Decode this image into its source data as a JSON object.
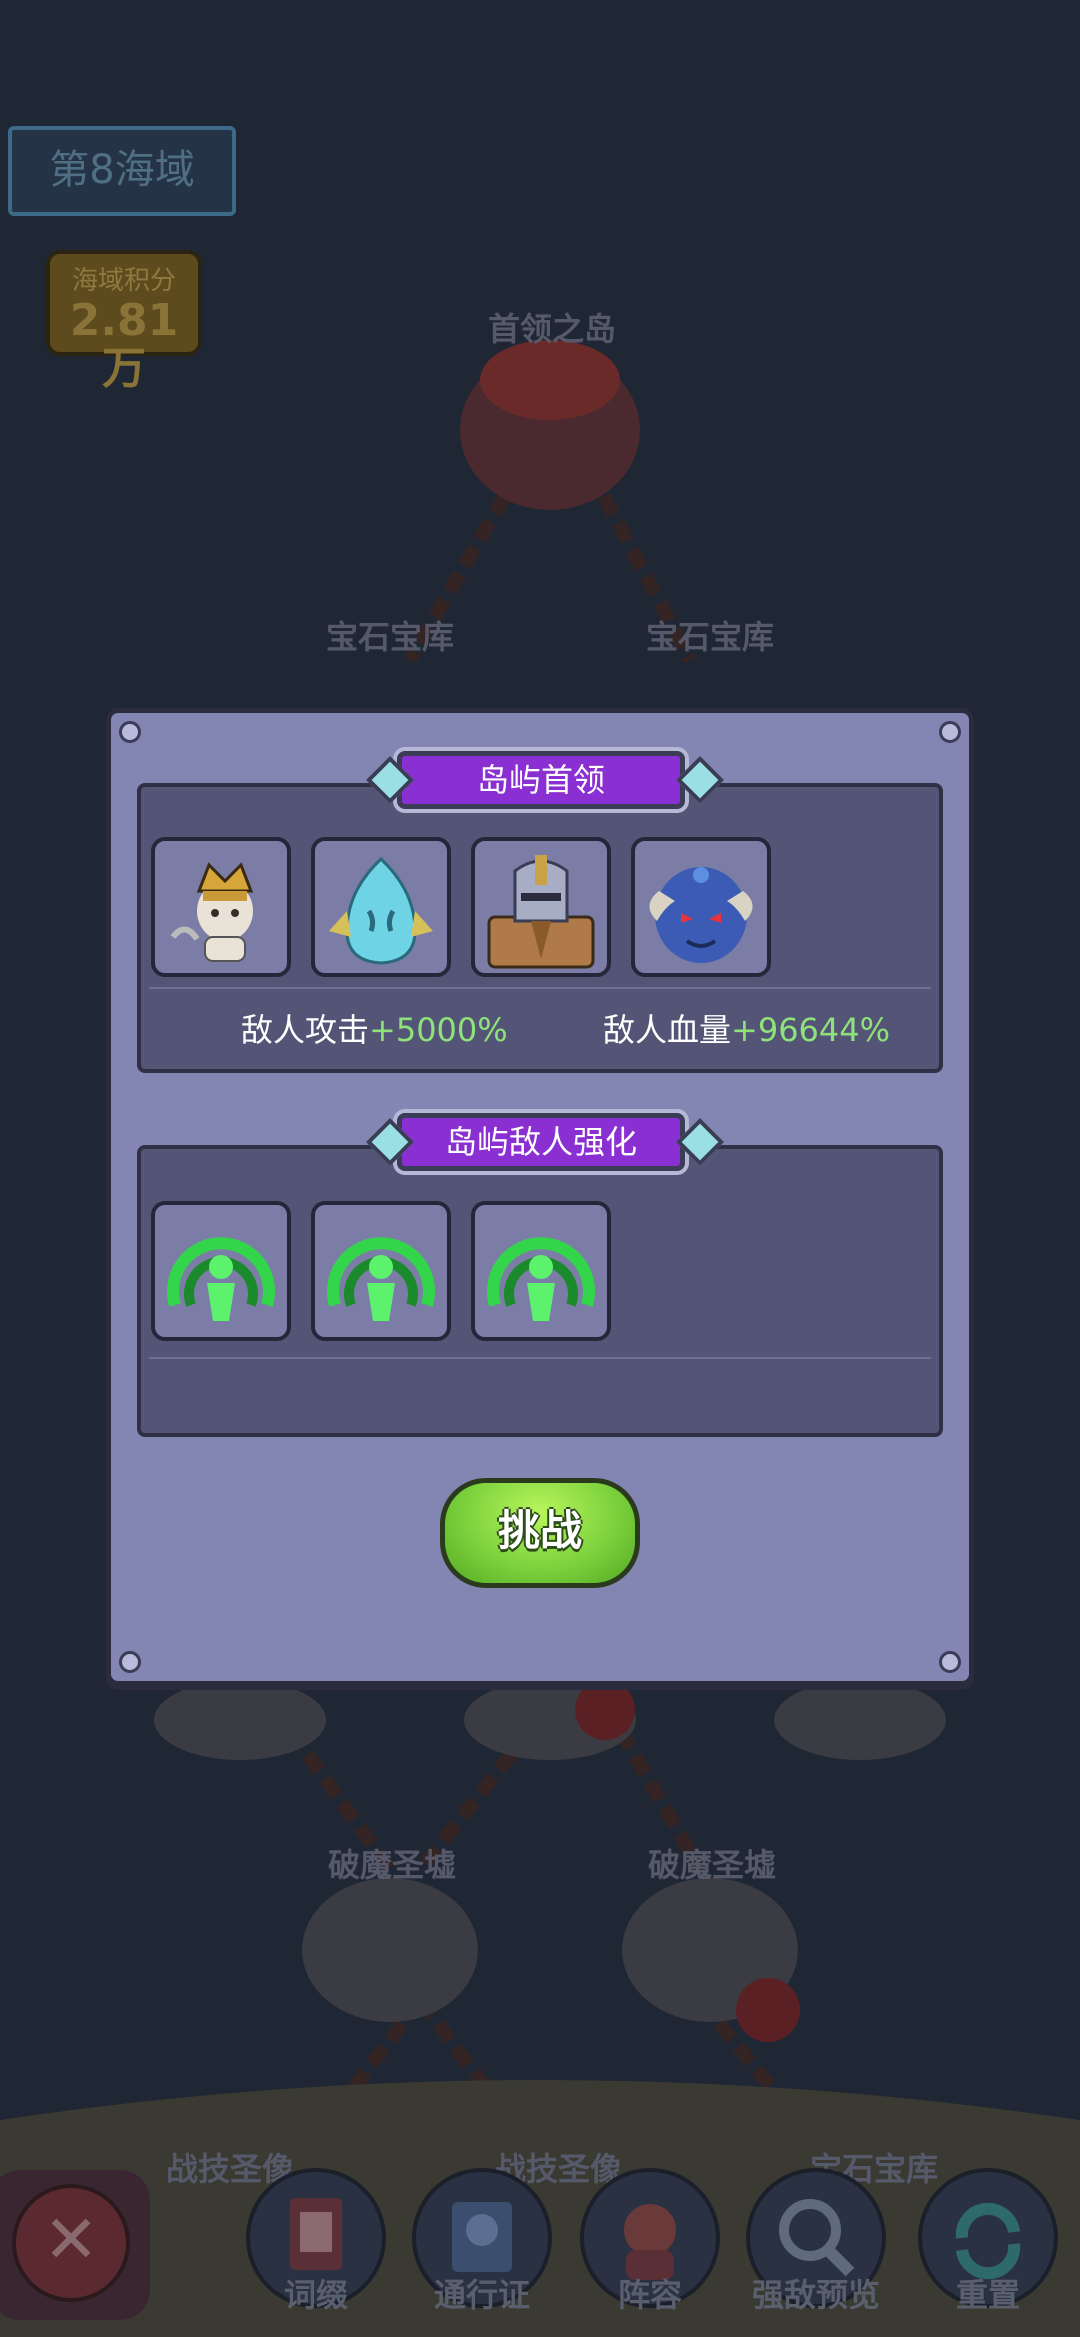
{
  "region": {
    "label": "第8海域"
  },
  "score": {
    "label": "海域积分",
    "value": "2.81万"
  },
  "map_labels": {
    "boss_island": "首领之岛",
    "gem_vault_left": "宝石宝库",
    "gem_vault_right": "宝石宝库",
    "demon_ruins_left": "破魔圣墟",
    "demon_ruins_right": "破魔圣墟",
    "combat_statue_left": "战技圣像",
    "combat_statue_mid": "战技圣像",
    "gem_vault_bottom": "宝石宝库"
  },
  "dialog": {
    "boss_section": {
      "title": "岛屿首领",
      "bosses": [
        "horned-warrior-icon",
        "water-spirit-icon",
        "armored-knight-icon",
        "blue-demon-icon"
      ],
      "attack_label": "敌人攻击",
      "attack_value": "+5000%",
      "hp_label": "敌人血量",
      "hp_value": "+96644%"
    },
    "buff_section": {
      "title": "岛屿敌人强化",
      "buffs": [
        "green-aura-icon",
        "green-aura-icon",
        "green-aura-icon"
      ]
    },
    "challenge_button": "挑战"
  },
  "bottom_nav": {
    "items": [
      "词缀",
      "通行证",
      "阵容",
      "强敌预览",
      "重置"
    ]
  },
  "colors": {
    "accent_purple": "#8a2fd1",
    "bonus_green": "#8ee27a",
    "button_green": "#78cf3a"
  }
}
